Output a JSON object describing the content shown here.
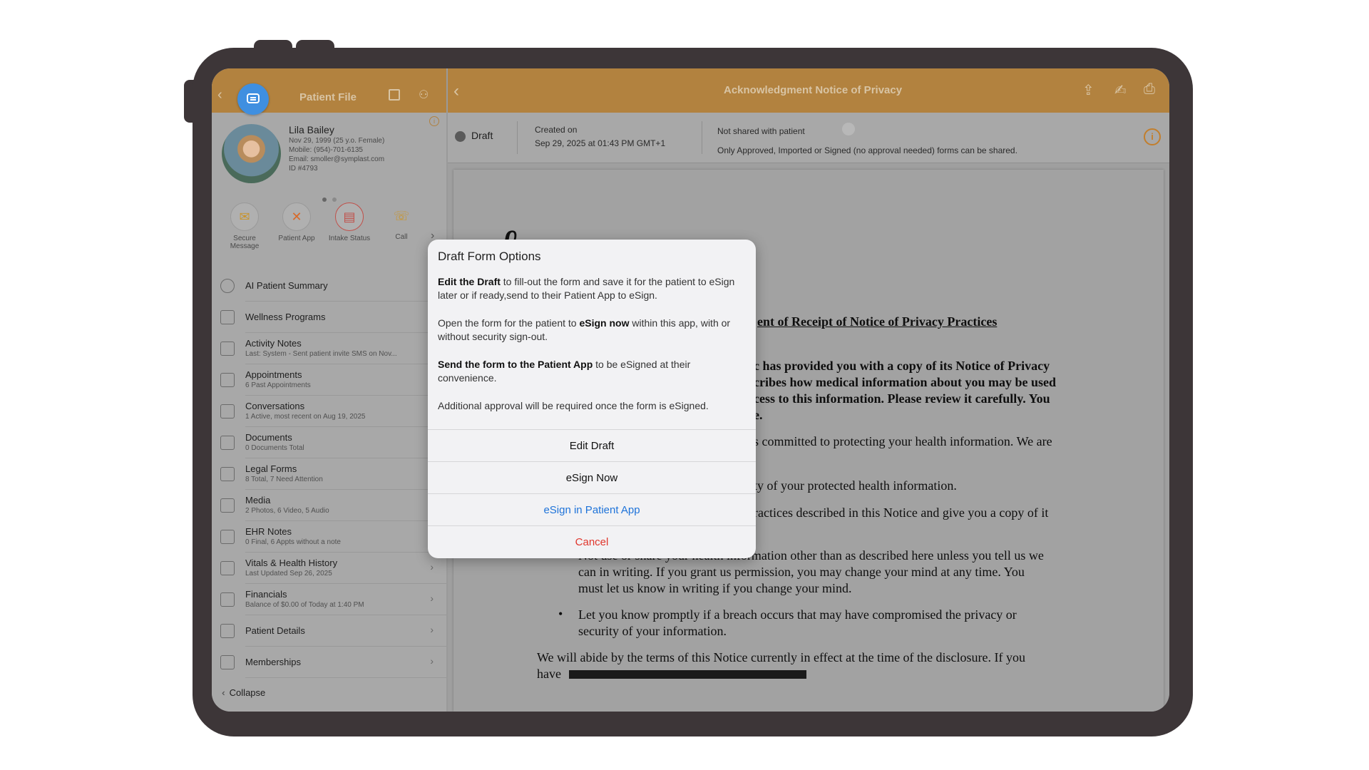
{
  "left_header": {
    "title": "Patient File"
  },
  "patient": {
    "name": "Lila Bailey",
    "dob": "Nov 29, 1999 (25 y.o. Female)",
    "mobile": "Mobile: (954)-701-6135",
    "email": "Email: smoller@symplast.com",
    "id": "ID #4793"
  },
  "actions": [
    {
      "label": "Secure Message"
    },
    {
      "label": "Patient App"
    },
    {
      "label": "Intake Status"
    },
    {
      "label": "Call"
    }
  ],
  "menu": [
    {
      "title": "AI Patient Summary",
      "sub": ""
    },
    {
      "title": "Wellness Programs",
      "sub": ""
    },
    {
      "title": "Activity Notes",
      "sub": "Last: System - Sent patient invite SMS on Nov..."
    },
    {
      "title": "Appointments",
      "sub": "6 Past Appointments"
    },
    {
      "title": "Conversations",
      "sub": "1 Active, most recent on Aug 19, 2025"
    },
    {
      "title": "Documents",
      "sub": "0 Documents Total"
    },
    {
      "title": "Legal Forms",
      "sub": "8 Total, 7 Need Attention"
    },
    {
      "title": "Media",
      "sub": "2 Photos, 6 Video, 5 Audio"
    },
    {
      "title": "EHR Notes",
      "sub": "0 Final, 6 Appts without a note"
    },
    {
      "title": "Vitals & Health History",
      "sub": "Last Updated Sep 26, 2025"
    },
    {
      "title": "Financials",
      "sub": "Balance of $0.00 of Today at 1:40 PM"
    },
    {
      "title": "Patient Details",
      "sub": ""
    },
    {
      "title": "Memberships",
      "sub": ""
    }
  ],
  "collapse_label": "Collapse",
  "right_header": {
    "title": "Acknowledgment Notice of Privacy"
  },
  "status": {
    "state": "Draft",
    "created_label": "Created on",
    "created_value": "Sep 29, 2025 at 01:43 PM GMT+1",
    "shared_label": "Not shared with patient",
    "shared_note": "Only Approved, Imported or Signed (no approval needed) forms can be shared."
  },
  "document": {
    "title": "ent of Receipt of Notice of Privacy Practices",
    "p1": [
      "c has provided you with a copy of its Notice of Privacy",
      "cribes how medical information about you may be used",
      "cess to this information.  Please review it carefully. You",
      "e."
    ],
    "p2": "s committed to protecting your health information. We are",
    "p3": "ty of your protected health information.",
    "p4": "ractices described in this Notice and give you a copy of it",
    "bullet1": [
      "Not use or share your health information other than as described here unless you tell us we",
      "can in writing. If you grant us permission, you may change your mind at any time. You",
      "must let us know in writing if you change your mind."
    ],
    "bullet2": [
      "Let you know promptly if a breach occurs that may have compromised the privacy or",
      "security of your information."
    ],
    "closing1": "We will abide by the terms of this Notice currently in effect at the time of the disclosure. If you",
    "closing2": "have"
  },
  "modal": {
    "title": "Draft Form Options",
    "p1_bold": "Edit the Draft",
    "p1_rest": " to fill-out the form and save it for the patient to eSign later or if ready,send to their Patient App to eSign.",
    "p2_pre": "Open the form for the patient to ",
    "p2_bold": "eSign now",
    "p2_rest": " within this app, with or without security sign-out.",
    "p3_bold": "Send the form to the Patient App",
    "p3_rest": " to be eSigned at their convenience.",
    "p4": "Additional approval will be required once the form is eSigned.",
    "buttons": {
      "edit": "Edit Draft",
      "esign_now": "eSign Now",
      "esign_app": "eSign in Patient App",
      "cancel": "Cancel"
    }
  },
  "colors": {
    "header": "#b2823f",
    "link": "#1e73d9",
    "danger": "#e0362c",
    "chat": "#3f8fe0"
  }
}
